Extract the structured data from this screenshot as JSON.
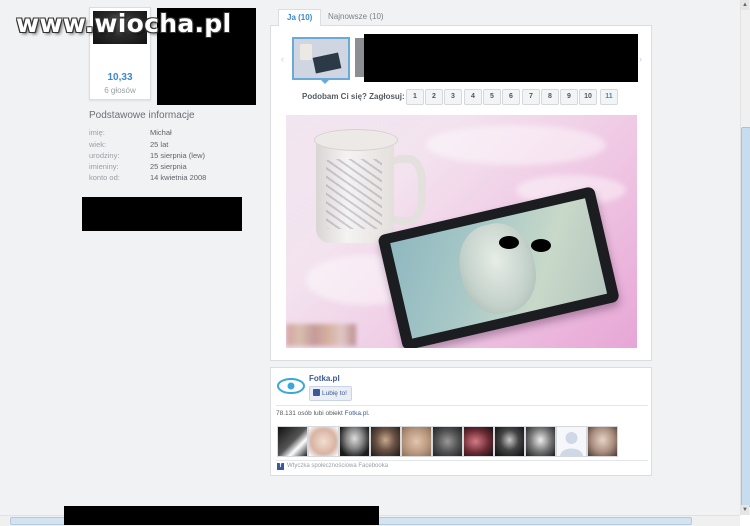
{
  "watermark": "www.wiocha.pl",
  "profile": {
    "rating": "10,33",
    "votes": "6 głosów",
    "info_title": "Podstawowe informacje",
    "fields": [
      {
        "key": "imię:",
        "value": "Michał"
      },
      {
        "key": "wiek:",
        "value": "25 lat"
      },
      {
        "key": "urodziny:",
        "value": "15 sierpnia (lew)"
      },
      {
        "key": "imieniny:",
        "value": "25 sierpnia"
      },
      {
        "key": "konto od:",
        "value": "14 kwietnia 2008"
      }
    ]
  },
  "tabs": [
    {
      "label": "Ja (10)",
      "active": true
    },
    {
      "label": "Najnowsze (10)",
      "active": false
    }
  ],
  "gallery": {
    "prev_arrow": "‹",
    "next_arrow": "›"
  },
  "voting": {
    "label": "Podobam Ci się? Zagłosuj:",
    "options": [
      "1",
      "2",
      "3",
      "4",
      "5",
      "6",
      "7",
      "8",
      "9",
      "10",
      "11"
    ],
    "highlighted": "11"
  },
  "facebook": {
    "page_name": "Fotka.pl",
    "like_button": "Lubię to!",
    "count_text": "78.131 osób lubi obiekt ",
    "count_link": "Fotka.pl",
    "count_end": ".",
    "plugin_text": "Wtyczka społecznościowa Facebooka",
    "brand_color": "#3b5998"
  },
  "accent_color": "#3d88c7"
}
